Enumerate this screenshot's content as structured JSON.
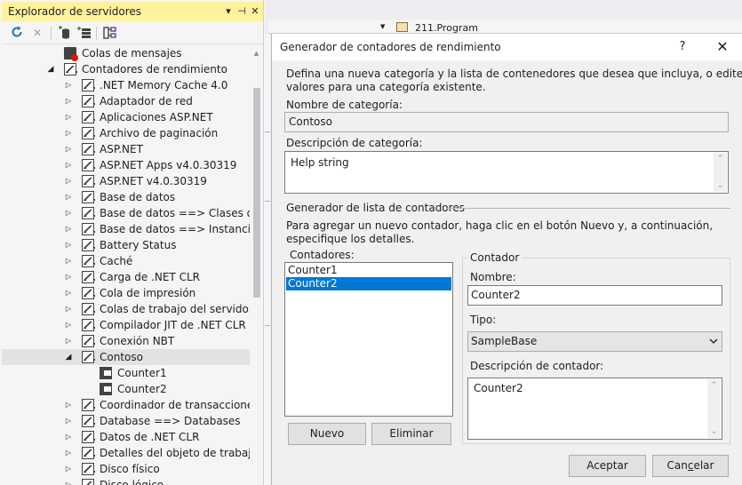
{
  "server_explorer": {
    "title": "Explorador de servidores",
    "title_buttons": {
      "dropdown": "▾",
      "pin": "⊣",
      "close": "✕"
    },
    "tree": [
      {
        "label": "Colas de mensajes",
        "icon": "message-queue-icon",
        "expander": "none",
        "selected": false
      },
      {
        "label": "Contadores de rendimiento",
        "icon": "performance-counters-icon",
        "expander": "open",
        "selected": false
      },
      {
        "label": ".NET Memory Cache 4.0",
        "icon": "performance-category-icon",
        "expander": "closed",
        "selected": false
      },
      {
        "label": "Adaptador de red",
        "icon": "performance-category-icon",
        "expander": "closed",
        "selected": false
      },
      {
        "label": "Aplicaciones ASP.NET",
        "icon": "performance-category-icon",
        "expander": "closed",
        "selected": false
      },
      {
        "label": "Archivo de paginación",
        "icon": "performance-category-icon",
        "expander": "closed",
        "selected": false
      },
      {
        "label": "ASP.NET",
        "icon": "performance-category-icon",
        "expander": "closed",
        "selected": false
      },
      {
        "label": "ASP.NET Apps v4.0.30319",
        "icon": "performance-category-icon",
        "expander": "closed",
        "selected": false
      },
      {
        "label": "ASP.NET v4.0.30319",
        "icon": "performance-category-icon",
        "expander": "closed",
        "selected": false
      },
      {
        "label": "Base de datos",
        "icon": "performance-category-icon",
        "expander": "closed",
        "selected": false
      },
      {
        "label": "Base de datos ==> Clases de tal",
        "icon": "performance-category-icon",
        "expander": "closed",
        "selected": false
      },
      {
        "label": "Base de datos ==> Instancias",
        "icon": "performance-category-icon",
        "expander": "closed",
        "selected": false
      },
      {
        "label": "Battery Status",
        "icon": "performance-category-icon",
        "expander": "closed",
        "selected": false
      },
      {
        "label": "Caché",
        "icon": "performance-category-icon",
        "expander": "closed",
        "selected": false
      },
      {
        "label": "Carga de .NET CLR",
        "icon": "performance-category-icon",
        "expander": "closed",
        "selected": false
      },
      {
        "label": "Cola de impresión",
        "icon": "performance-category-icon",
        "expander": "closed",
        "selected": false
      },
      {
        "label": "Colas de trabajo del servidor",
        "icon": "performance-category-icon",
        "expander": "closed",
        "selected": false
      },
      {
        "label": "Compilador JIT de .NET CLR",
        "icon": "performance-category-icon",
        "expander": "closed",
        "selected": false
      },
      {
        "label": "Conexión NBT",
        "icon": "performance-category-icon",
        "expander": "closed",
        "selected": false
      },
      {
        "label": "Contoso",
        "icon": "performance-category-icon",
        "expander": "open",
        "selected": true
      },
      {
        "label": "Counter1",
        "icon": "counter-icon",
        "expander": "none",
        "selected": false
      },
      {
        "label": "Counter2",
        "icon": "counter-icon",
        "expander": "none",
        "selected": false
      },
      {
        "label": "Coordinador de transacciones d",
        "icon": "performance-category-icon",
        "expander": "closed",
        "selected": false
      },
      {
        "label": "Database ==> Databases",
        "icon": "performance-category-icon",
        "expander": "closed",
        "selected": false
      },
      {
        "label": "Datos de .NET CLR",
        "icon": "performance-category-icon",
        "expander": "closed",
        "selected": false
      },
      {
        "label": "Detalles del objeto de trabajo",
        "icon": "performance-category-icon",
        "expander": "closed",
        "selected": false
      },
      {
        "label": "Disco físico",
        "icon": "performance-category-icon",
        "expander": "closed",
        "selected": false
      },
      {
        "label": "Disco lógico",
        "icon": "performance-category-icon",
        "expander": "closed",
        "selected": false
      }
    ]
  },
  "editor": {
    "tab_label": "211.Program"
  },
  "dialog": {
    "title": "Generador de contadores de rendimiento",
    "help_label": "?",
    "close_label": "✕",
    "intro": {
      "line1": "Defina una nueva categoría y la lista de contenedores que desea que incluya, o edite los",
      "line2": "valores para una categoría existente."
    },
    "category_name_label": "Nombre de categoría:",
    "category_name_value": "Contoso",
    "category_description_label": "Descripción de categoría:",
    "category_description_value": "Help string",
    "counter_list_group_label": "Generador de lista de contadores",
    "counter_list_help": {
      "line1": "Para agregar un nuevo contador, haga clic en el botón Nuevo y, a continuación,",
      "line2": "especifique los detalles."
    },
    "counters_label": "Contadores:",
    "counters": [
      {
        "label": "Counter1",
        "selected": false
      },
      {
        "label": "Counter2",
        "selected": true
      }
    ],
    "new_button": "Nuevo",
    "delete_button": "Eliminar",
    "counter_group_label": "Contador",
    "counter_name_label": "Nombre:",
    "counter_name_value": "Counter2",
    "counter_type_label": "Tipo:",
    "counter_type_value": "SampleBase",
    "counter_description_label": "Descripción de contador:",
    "counter_description_value": "Counter2",
    "ok_button": "Aceptar",
    "cancel_button_pre": "Can",
    "cancel_button_ul": "c",
    "cancel_button_post": "elar"
  },
  "colors": {
    "title_bar_active": "#fff29d",
    "selection": "#0078d7",
    "tree_selected_row": "#e2e2e2"
  }
}
